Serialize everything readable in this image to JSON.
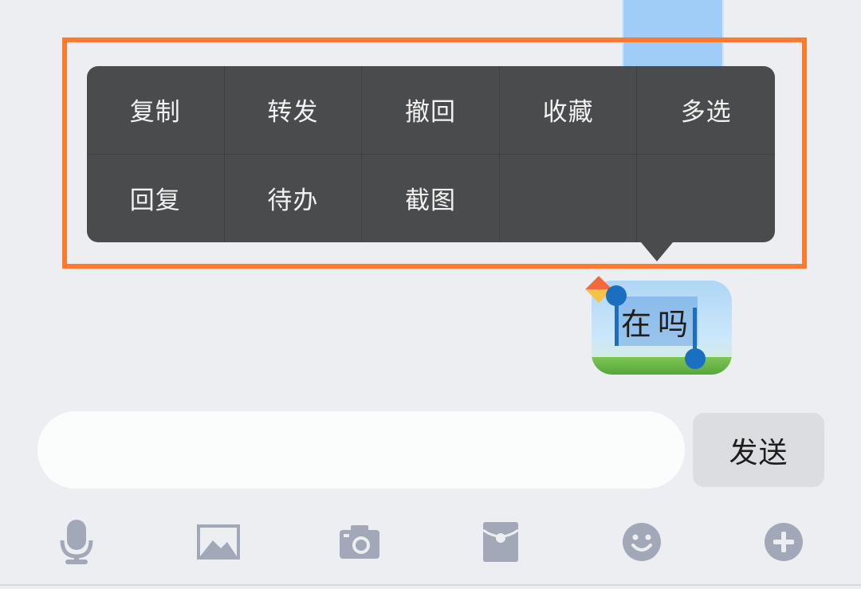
{
  "context_menu": {
    "items": [
      {
        "label": "复制"
      },
      {
        "label": "转发"
      },
      {
        "label": "撤回"
      },
      {
        "label": "收藏"
      },
      {
        "label": "多选"
      },
      {
        "label": "回复"
      },
      {
        "label": "待办"
      },
      {
        "label": "截图"
      },
      {
        "label": ""
      },
      {
        "label": ""
      }
    ]
  },
  "message": {
    "text": "在吗"
  },
  "composer": {
    "input_value": "",
    "send_label": "发送"
  },
  "toolbar": {
    "icons": [
      "microphone-icon",
      "image-icon",
      "camera-icon",
      "red-packet-icon",
      "emoji-icon",
      "plus-icon"
    ]
  },
  "colors": {
    "highlight": "#ff7a2e",
    "menu_bg": "#4a4b4c",
    "icon": "#a3a8b8",
    "selection": "#1a6fc0"
  }
}
